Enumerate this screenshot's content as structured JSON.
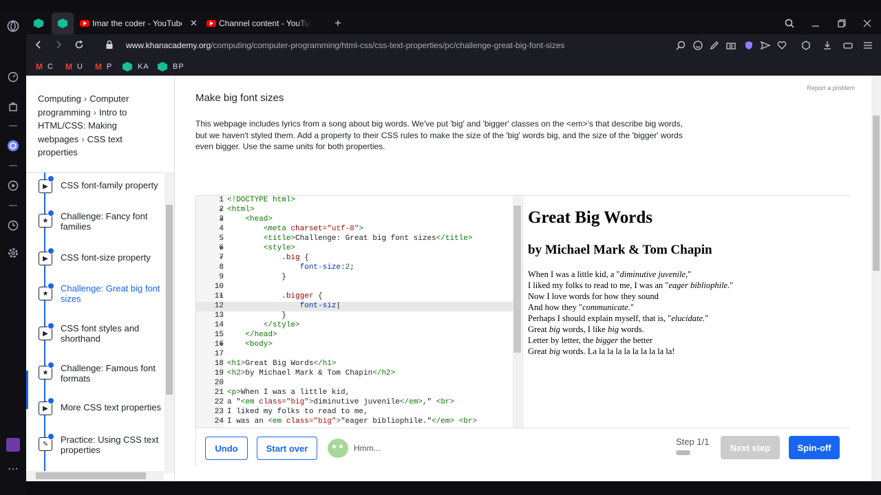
{
  "tabs": [
    {
      "label": "Imar the coder - YouTube",
      "close": "✕"
    },
    {
      "label": "Channel content - YouTube",
      "close": ""
    }
  ],
  "url": {
    "domain": "www.khanacademy.org",
    "path": "/computing/computer-programming/html-css/css-text-properties/pc/challenge-great-big-font-sizes"
  },
  "bookmarks": [
    {
      "icon": "gmail-icon",
      "label": "C"
    },
    {
      "icon": "gmail-icon",
      "label": "U"
    },
    {
      "icon": "gmail-icon",
      "label": "P"
    },
    {
      "icon": "khan-academy-icon",
      "label": "KA"
    },
    {
      "icon": "khan-academy-icon",
      "label": "BP"
    }
  ],
  "breadcrumb": [
    "Computing",
    "Computer programming",
    "Intro to HTML/CSS: Making webpages",
    "CSS text properties"
  ],
  "lessons": [
    {
      "label": "CSS font-family property",
      "icon": "play-icon",
      "active": false
    },
    {
      "label": "Challenge: Fancy font families",
      "icon": "star-icon",
      "active": false
    },
    {
      "label": "CSS font-size property",
      "icon": "play-icon",
      "active": false
    },
    {
      "label": "Challenge: Great big font sizes",
      "icon": "star-icon",
      "active": true
    },
    {
      "label": "CSS font styles and shorthand",
      "icon": "play-icon",
      "active": false
    },
    {
      "label": "Challenge: Famous font formats",
      "icon": "star-icon",
      "active": false
    },
    {
      "label": "More CSS text properties",
      "icon": "play-icon",
      "active": false
    },
    {
      "label": "Practice: Using CSS text properties",
      "icon": "pencil-icon",
      "active": false
    }
  ],
  "main": {
    "report": "Report a problem",
    "title": "Make big font sizes",
    "description": "This webpage includes lyrics from a song about big words. We've put 'big' and 'bigger' classes on the <em>'s that describe big words, but we haven't styled them. Add a property to their CSS rules to make the size of the 'big' words big, and the size of the 'bigger' words even bigger. Use the same units for both properties."
  },
  "editor": {
    "line_numbers": [
      "1",
      "2",
      "3",
      "4",
      "5",
      "6",
      "7",
      "8",
      "9",
      "10",
      "11",
      "12",
      "13",
      "14",
      "15",
      "16",
      "17",
      "18",
      "19",
      "20",
      "21",
      "22",
      "23",
      "24"
    ]
  },
  "preview": {
    "h1": "Great Big Words",
    "h2": "by Michael Mark & Tom Chapin",
    "lines": [
      "When I was a little kid, a \"diminutive juvenile,\"",
      "I liked my folks to read to me, I was an \"eager bibliophile.\"",
      "Now I love words for how they sound",
      "And how they \"communicate.\"",
      "Perhaps I should explain myself, that is, \"elucidate.\"",
      "Great big words, I like big words.",
      "Letter by letter, the bigger the better",
      "Great big words. La la la la la la la la la la!"
    ]
  },
  "toolbar": {
    "undo": "Undo",
    "start_over": "Start over",
    "hmm": "Hmm...",
    "step": "Step 1/1",
    "next_step": "Next step",
    "spinoff": "Spin-off"
  }
}
